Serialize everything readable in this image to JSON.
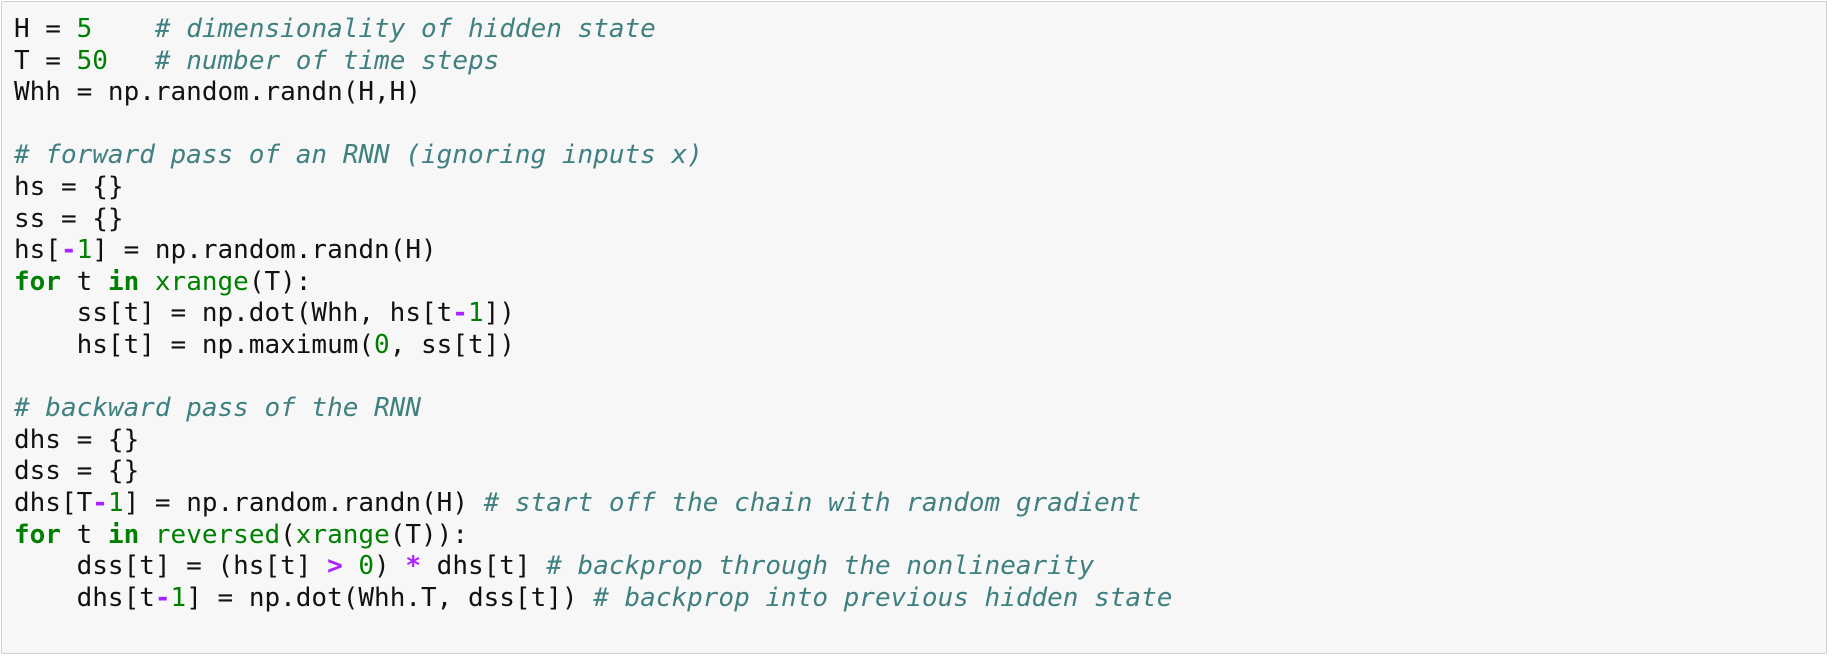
{
  "colors": {
    "background": "#f7f7f7",
    "border": "#cfcfcf",
    "text": "#111111",
    "comment": "#408080",
    "number": "#008000",
    "keyword": "#008000",
    "operator": "#aa22ff"
  },
  "code": {
    "lines": [
      [
        {
          "t": "plain",
          "s": "H = "
        },
        {
          "t": "number",
          "s": "5"
        },
        {
          "t": "plain",
          "s": "    "
        },
        {
          "t": "comment",
          "s": "# dimensionality of hidden state"
        }
      ],
      [
        {
          "t": "plain",
          "s": "T = "
        },
        {
          "t": "number",
          "s": "50"
        },
        {
          "t": "plain",
          "s": "   "
        },
        {
          "t": "comment",
          "s": "# number of time steps"
        }
      ],
      [
        {
          "t": "plain",
          "s": "Whh = np.random.randn(H,H)"
        }
      ],
      [],
      [
        {
          "t": "comment",
          "s": "# forward pass of an RNN (ignoring inputs x)"
        }
      ],
      [
        {
          "t": "plain",
          "s": "hs = {}"
        }
      ],
      [
        {
          "t": "plain",
          "s": "ss = {}"
        }
      ],
      [
        {
          "t": "plain",
          "s": "hs["
        },
        {
          "t": "op",
          "s": "-"
        },
        {
          "t": "number",
          "s": "1"
        },
        {
          "t": "plain",
          "s": "] = np.random.randn(H)"
        }
      ],
      [
        {
          "t": "keyword",
          "s": "for"
        },
        {
          "t": "plain",
          "s": " t "
        },
        {
          "t": "keyword",
          "s": "in"
        },
        {
          "t": "plain",
          "s": " "
        },
        {
          "t": "builtin",
          "s": "xrange"
        },
        {
          "t": "plain",
          "s": "(T):"
        }
      ],
      [
        {
          "t": "plain",
          "s": "    ss[t] = np.dot(Whh, hs[t"
        },
        {
          "t": "op",
          "s": "-"
        },
        {
          "t": "number",
          "s": "1"
        },
        {
          "t": "plain",
          "s": "])"
        }
      ],
      [
        {
          "t": "plain",
          "s": "    hs[t] = np.maximum("
        },
        {
          "t": "number",
          "s": "0"
        },
        {
          "t": "plain",
          "s": ", ss[t])"
        }
      ],
      [],
      [
        {
          "t": "comment",
          "s": "# backward pass of the RNN"
        }
      ],
      [
        {
          "t": "plain",
          "s": "dhs = {}"
        }
      ],
      [
        {
          "t": "plain",
          "s": "dss = {}"
        }
      ],
      [
        {
          "t": "plain",
          "s": "dhs[T"
        },
        {
          "t": "op",
          "s": "-"
        },
        {
          "t": "number",
          "s": "1"
        },
        {
          "t": "plain",
          "s": "] = np.random.randn(H) "
        },
        {
          "t": "comment",
          "s": "# start off the chain with random gradient"
        }
      ],
      [
        {
          "t": "keyword",
          "s": "for"
        },
        {
          "t": "plain",
          "s": " t "
        },
        {
          "t": "keyword",
          "s": "in"
        },
        {
          "t": "plain",
          "s": " "
        },
        {
          "t": "builtin",
          "s": "reversed"
        },
        {
          "t": "plain",
          "s": "("
        },
        {
          "t": "builtin",
          "s": "xrange"
        },
        {
          "t": "plain",
          "s": "(T)):"
        }
      ],
      [
        {
          "t": "plain",
          "s": "    dss[t] = (hs[t] "
        },
        {
          "t": "op",
          "s": ">"
        },
        {
          "t": "plain",
          "s": " "
        },
        {
          "t": "number",
          "s": "0"
        },
        {
          "t": "plain",
          "s": ") "
        },
        {
          "t": "op",
          "s": "*"
        },
        {
          "t": "plain",
          "s": " dhs[t] "
        },
        {
          "t": "comment",
          "s": "# backprop through the nonlinearity"
        }
      ],
      [
        {
          "t": "plain",
          "s": "    dhs[t"
        },
        {
          "t": "op",
          "s": "-"
        },
        {
          "t": "number",
          "s": "1"
        },
        {
          "t": "plain",
          "s": "] = np.dot(Whh.T, dss[t]) "
        },
        {
          "t": "comment",
          "s": "# backprop into previous hidden state"
        }
      ]
    ]
  }
}
